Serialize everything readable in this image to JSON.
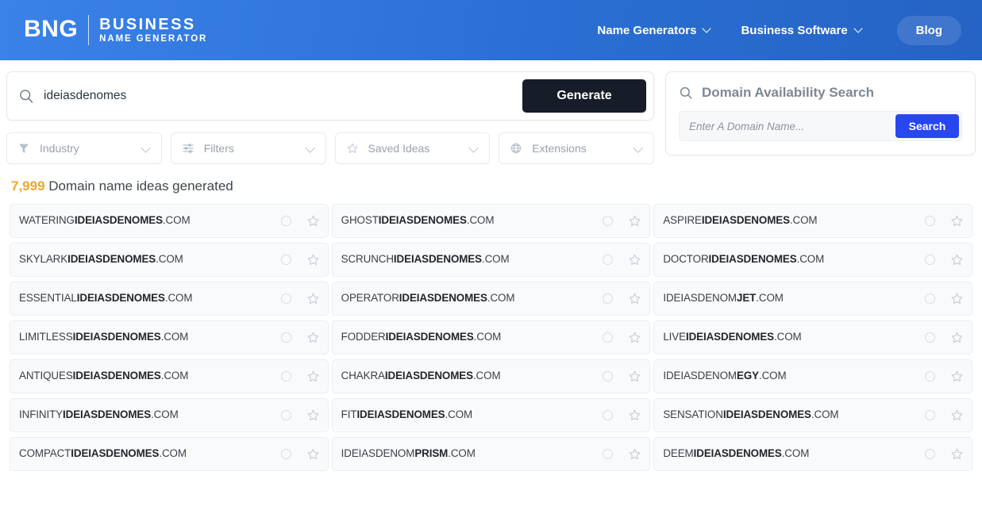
{
  "header": {
    "logo_mark": "BNG",
    "logo_line1": "BUSINESS",
    "logo_line2": "NAME GENERATOR",
    "nav": [
      {
        "label": "Name Generators",
        "has_chevron": true,
        "icon": "chevron-down-icon"
      },
      {
        "label": "Business Software",
        "has_chevron": true,
        "icon": "chevron-down-icon"
      },
      {
        "label": "Blog",
        "has_chevron": false
      }
    ],
    "brand_color": "#2a6fd4"
  },
  "search": {
    "icon": "search-icon",
    "value": "ideiasdenomes",
    "placeholder": "",
    "generate_label": "Generate",
    "generate_color": "#161c28"
  },
  "filters": [
    {
      "label": "Industry",
      "icon": "funnel-icon"
    },
    {
      "label": "Filters",
      "icon": "sliders-icon"
    },
    {
      "label": "Saved Ideas",
      "icon": "star-icon"
    },
    {
      "label": "Extensions",
      "icon": "globe-icon"
    }
  ],
  "availability": {
    "icon": "search-icon",
    "title": "Domain Availability Search",
    "input_value": "",
    "input_placeholder": "Enter A Domain Name...",
    "search_label": "Search",
    "search_color": "#2947f0"
  },
  "results": {
    "count": "7,999",
    "count_color": "#f0a52b",
    "caption": " Domain name ideas generated",
    "row_icons": {
      "status": "loading-circle-icon",
      "favorite": "star-outline-icon"
    },
    "items": [
      {
        "prefix": "WATERING",
        "keyword": "IDEIASDENOMES",
        "suffix": "",
        "tld": ".COM"
      },
      {
        "prefix": "GHOST",
        "keyword": "IDEIASDENOMES",
        "suffix": "",
        "tld": ".COM"
      },
      {
        "prefix": "ASPIRE",
        "keyword": "IDEIASDENOMES",
        "suffix": "",
        "tld": ".COM"
      },
      {
        "prefix": "SKYLARK",
        "keyword": "IDEIASDENOMES",
        "suffix": "",
        "tld": ".COM"
      },
      {
        "prefix": "SCRUNCH",
        "keyword": "IDEIASDENOMES",
        "suffix": "",
        "tld": ".COM"
      },
      {
        "prefix": "DOCTOR",
        "keyword": "IDEIASDENOMES",
        "suffix": "",
        "tld": ".COM"
      },
      {
        "prefix": "ESSENTIAL",
        "keyword": "IDEIASDENOMES",
        "suffix": "",
        "tld": ".COM"
      },
      {
        "prefix": "OPERATOR",
        "keyword": "IDEIASDENOMES",
        "suffix": "",
        "tld": ".COM"
      },
      {
        "prefix": "IDEIASDENOM",
        "keyword": "JET",
        "suffix": "",
        "tld": ".COM"
      },
      {
        "prefix": "LIMITLESS",
        "keyword": "IDEIASDENOMES",
        "suffix": "",
        "tld": ".COM"
      },
      {
        "prefix": "FODDER",
        "keyword": "IDEIASDENOMES",
        "suffix": "",
        "tld": ".COM"
      },
      {
        "prefix": "LIVE",
        "keyword": "IDEIASDENOMES",
        "suffix": "",
        "tld": ".COM"
      },
      {
        "prefix": "ANTIQUES",
        "keyword": "IDEIASDENOMES",
        "suffix": "",
        "tld": ".COM"
      },
      {
        "prefix": "CHAKRA",
        "keyword": "IDEIASDENOMES",
        "suffix": "",
        "tld": ".COM"
      },
      {
        "prefix": "IDEIASDENOM",
        "keyword": "EGY",
        "suffix": "",
        "tld": ".COM"
      },
      {
        "prefix": "INFINITY",
        "keyword": "IDEIASDENOMES",
        "suffix": "",
        "tld": ".COM"
      },
      {
        "prefix": "FIT",
        "keyword": "IDEIASDENOMES",
        "suffix": "",
        "tld": ".COM"
      },
      {
        "prefix": "SENSATION",
        "keyword": "IDEIASDENOMES",
        "suffix": "",
        "tld": ".COM"
      },
      {
        "prefix": "COMPACT",
        "keyword": "IDEIASDENOMES",
        "suffix": "",
        "tld": ".COM"
      },
      {
        "prefix": "IDEIASDENOM",
        "keyword": "PRISM",
        "suffix": "",
        "tld": ".COM"
      },
      {
        "prefix": "DEEM",
        "keyword": "IDEIASDENOMES",
        "suffix": "",
        "tld": ".COM"
      }
    ]
  }
}
